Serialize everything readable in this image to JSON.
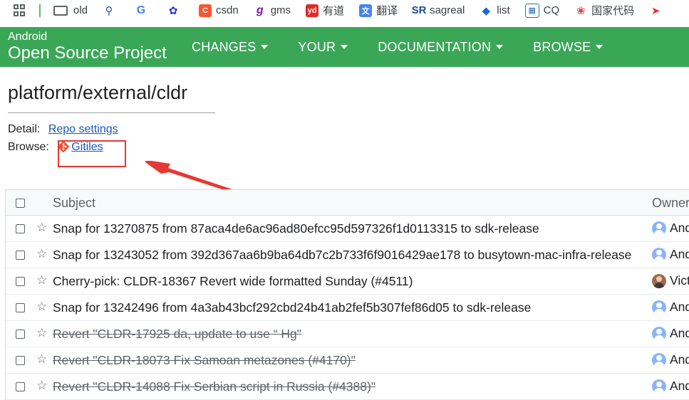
{
  "bookmarks": [
    {
      "label": "old",
      "icon": "folder-icon"
    },
    {
      "label": "",
      "icon": "search-icon"
    },
    {
      "label": "",
      "icon": "google-icon"
    },
    {
      "label": "",
      "icon": "baidu-icon"
    },
    {
      "label": "csdn",
      "icon": "csdn-icon",
      "color": "#fc5531"
    },
    {
      "label": "gms",
      "icon": "gms-icon",
      "color": "#7b1fa2"
    },
    {
      "label": "有道",
      "icon": "youdao-icon",
      "color": "#e02a2a"
    },
    {
      "label": "翻译",
      "icon": "translate-icon",
      "color": "#4285f4"
    },
    {
      "label": "sagreal",
      "icon": "sr-icon",
      "color": "#1a4fa3"
    },
    {
      "label": "list",
      "icon": "jira-icon",
      "color": "#1868db"
    },
    {
      "label": "CQ",
      "icon": "cq-icon",
      "color": "#2a6fb0"
    },
    {
      "label": "国家代码",
      "icon": "flower-icon",
      "color": "#d84343"
    },
    {
      "label": "",
      "icon": "rocket-icon",
      "color": "#e53935"
    }
  ],
  "nav": {
    "brand_small": "Android",
    "brand_big": "Open Source Project",
    "menus": [
      "CHANGES",
      "YOUR",
      "DOCUMENTATION",
      "BROWSE"
    ]
  },
  "page": {
    "title": "platform/external/cldr",
    "detail_label": "Detail:",
    "detail_link": "Repo settings",
    "browse_label": "Browse:",
    "browse_link": "Gitiles"
  },
  "table": {
    "headers": {
      "subject": "Subject",
      "owner": "Owner"
    },
    "rows": [
      {
        "subject": "Snap for 13270875 from 87aca4de6ac96ad80efcc95d597326f1d0113315 to sdk-release",
        "owner": "And",
        "avatar": "default",
        "abandoned": false
      },
      {
        "subject": "Snap for 13243052 from 392d367aa6b9ba64db7c2b733f6f9016429ae178 to busytown-mac-infra-release",
        "owner": "And",
        "avatar": "default",
        "abandoned": false
      },
      {
        "subject": "Cherry-pick: CLDR-18367 Revert wide formatted Sunday (#4511)",
        "owner": "Vict",
        "avatar": "photo",
        "abandoned": false
      },
      {
        "subject": "Snap for 13242496 from 4a3ab43bcf292cbd24b41ab2fef5b307fef86d05 to sdk-release",
        "owner": "And",
        "avatar": "default",
        "abandoned": false
      },
      {
        "subject": "Revert \"CLDR-17925 da, update to use “ Hg\"",
        "owner": "And",
        "avatar": "default",
        "abandoned": true
      },
      {
        "subject": "Revert \"CLDR-18073 Fix Samoan metazones (#4170)\"",
        "owner": "And",
        "avatar": "default",
        "abandoned": true
      },
      {
        "subject": "Revert \"CLDR-14088 Fix Serbian script in Russia (#4388)\"",
        "owner": "And",
        "avatar": "default",
        "abandoned": true
      }
    ]
  },
  "colors": {
    "nav_bg": "#3aa757",
    "link": "#1a59c8",
    "annotation": "#e53935"
  }
}
